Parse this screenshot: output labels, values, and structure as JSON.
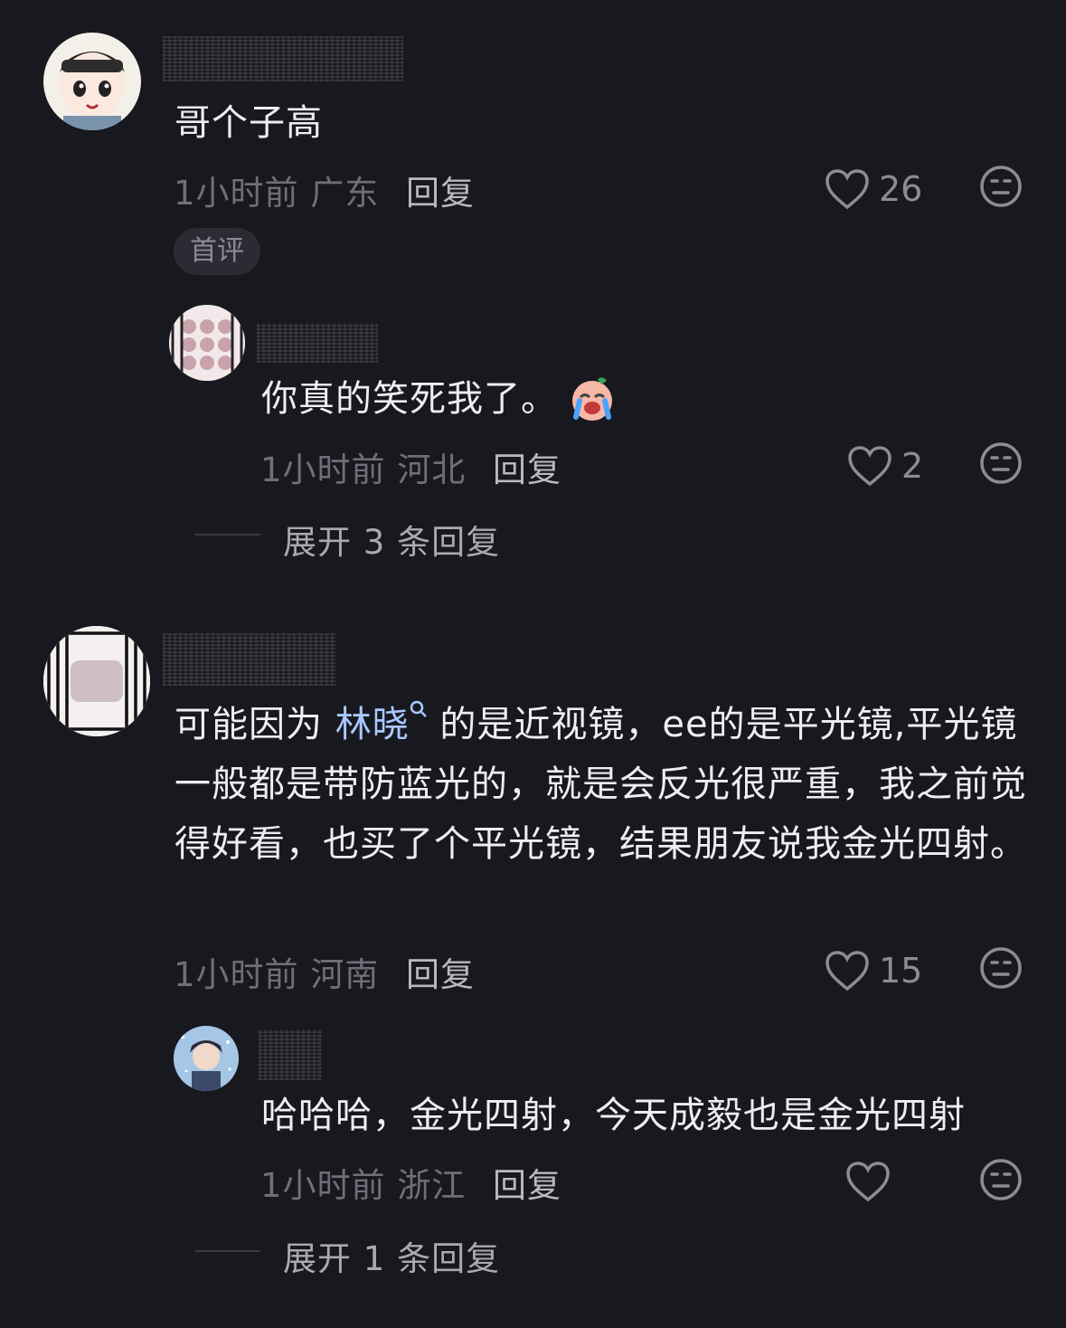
{
  "comments": [
    {
      "text": "哥个子高",
      "time": "1小时前",
      "location": "广东",
      "reply_label": "回复",
      "likes": "26",
      "badge": "首评",
      "replies": [
        {
          "text": "你真的笑死我了。",
          "emoji_icon": "crying-laughing-emoji",
          "time": "1小时前",
          "location": "河北",
          "reply_label": "回复",
          "likes": "2"
        }
      ],
      "expand_label": "展开 3 条回复"
    },
    {
      "text_prefix": "可能因为 ",
      "mention": "林晓",
      "text_suffix": " 的是近视镜，ee的是平光镜,平光镜一般都是带防蓝光的，就是会反光很严重，我之前觉得好看，也买了个平光镜，结果朋友说我金光四射。",
      "time": "1小时前",
      "location": "河南",
      "reply_label": "回复",
      "likes": "15",
      "replies": [
        {
          "text": "哈哈哈，金光四射，今天成毅也是金光四射",
          "time": "1小时前",
          "location": "浙江",
          "reply_label": "回复",
          "likes": ""
        }
      ],
      "expand_label": "展开 1 条回复"
    }
  ],
  "colors": {
    "background": "#18181f",
    "text": "#eeeef0",
    "meta": "#6f6f79",
    "mention": "#a9c8ff"
  }
}
